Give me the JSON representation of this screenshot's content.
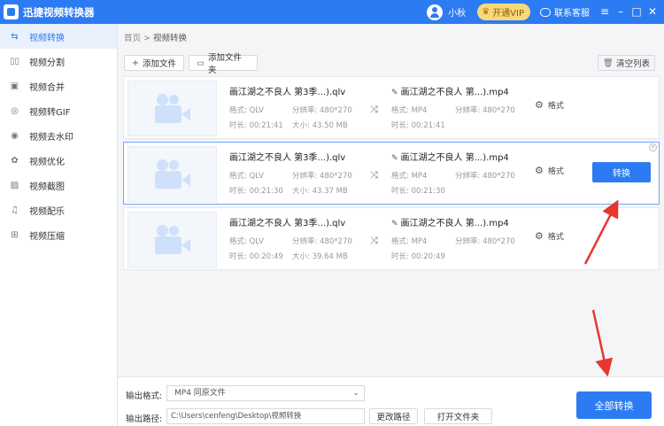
{
  "app": {
    "title": "迅捷视频转换器",
    "username": "小秋",
    "vip_label": "开通VIP",
    "support_label": "联系客服"
  },
  "colors": {
    "primary": "#2d7bf2",
    "vip_bg": "#f9d87a",
    "arrow": "#e8352e"
  },
  "sidebar": {
    "items": [
      {
        "label": "视频转换",
        "icon": "convert-icon",
        "active": true
      },
      {
        "label": "视频分割",
        "icon": "split-icon"
      },
      {
        "label": "视频合并",
        "icon": "merge-icon"
      },
      {
        "label": "视频转GIF",
        "icon": "gif-icon"
      },
      {
        "label": "视频去水印",
        "icon": "watermark-icon"
      },
      {
        "label": "视频优化",
        "icon": "optimize-icon"
      },
      {
        "label": "视频截图",
        "icon": "screenshot-icon"
      },
      {
        "label": "视频配乐",
        "icon": "music-icon"
      },
      {
        "label": "视频压缩",
        "icon": "compress-icon"
      }
    ]
  },
  "breadcrumb": {
    "home": "首页",
    "sep": ">",
    "current": "视频转换"
  },
  "toolbar": {
    "add_file": "添加文件",
    "add_folder": "添加文件夹",
    "clear_list": "清空列表"
  },
  "labels": {
    "format": "格式:",
    "resolution": "分辨率:",
    "duration": "时长:",
    "size": "大小:",
    "format_setting": "格式",
    "convert": "转换"
  },
  "files": [
    {
      "src_name": "画江湖之不良人 第3季...).qlv",
      "src_format": "QLV",
      "src_res": "480*270",
      "src_duration": "00:21:41",
      "src_size": "43.50 MB",
      "out_name": "画江湖之不良人 第...).mp4",
      "out_format": "MP4",
      "out_res": "480*270",
      "out_duration": "00:21:41"
    },
    {
      "src_name": "画江湖之不良人 第3季...).qlv",
      "src_format": "QLV",
      "src_res": "480*270",
      "src_duration": "00:21:30",
      "src_size": "43.37 MB",
      "out_name": "画江湖之不良人 第...).mp4",
      "out_format": "MP4",
      "out_res": "480*270",
      "out_duration": "00:21:30"
    },
    {
      "src_name": "画江湖之不良人 第3季...).qlv",
      "src_format": "QLV",
      "src_res": "480*270",
      "src_duration": "00:20:49",
      "src_size": "39.64 MB",
      "out_name": "画江湖之不良人 第...).mp4",
      "out_format": "MP4",
      "out_res": "480*270",
      "out_duration": "00:20:49"
    }
  ],
  "bottom": {
    "output_format_label": "输出格式:",
    "output_format_value": "MP4  同原文件",
    "output_path_label": "输出路径:",
    "output_path_value": "C:\\Users\\cenfeng\\Desktop\\视频转换",
    "change_path": "更改路径",
    "open_folder": "打开文件夹",
    "convert_all": "全部转换"
  }
}
